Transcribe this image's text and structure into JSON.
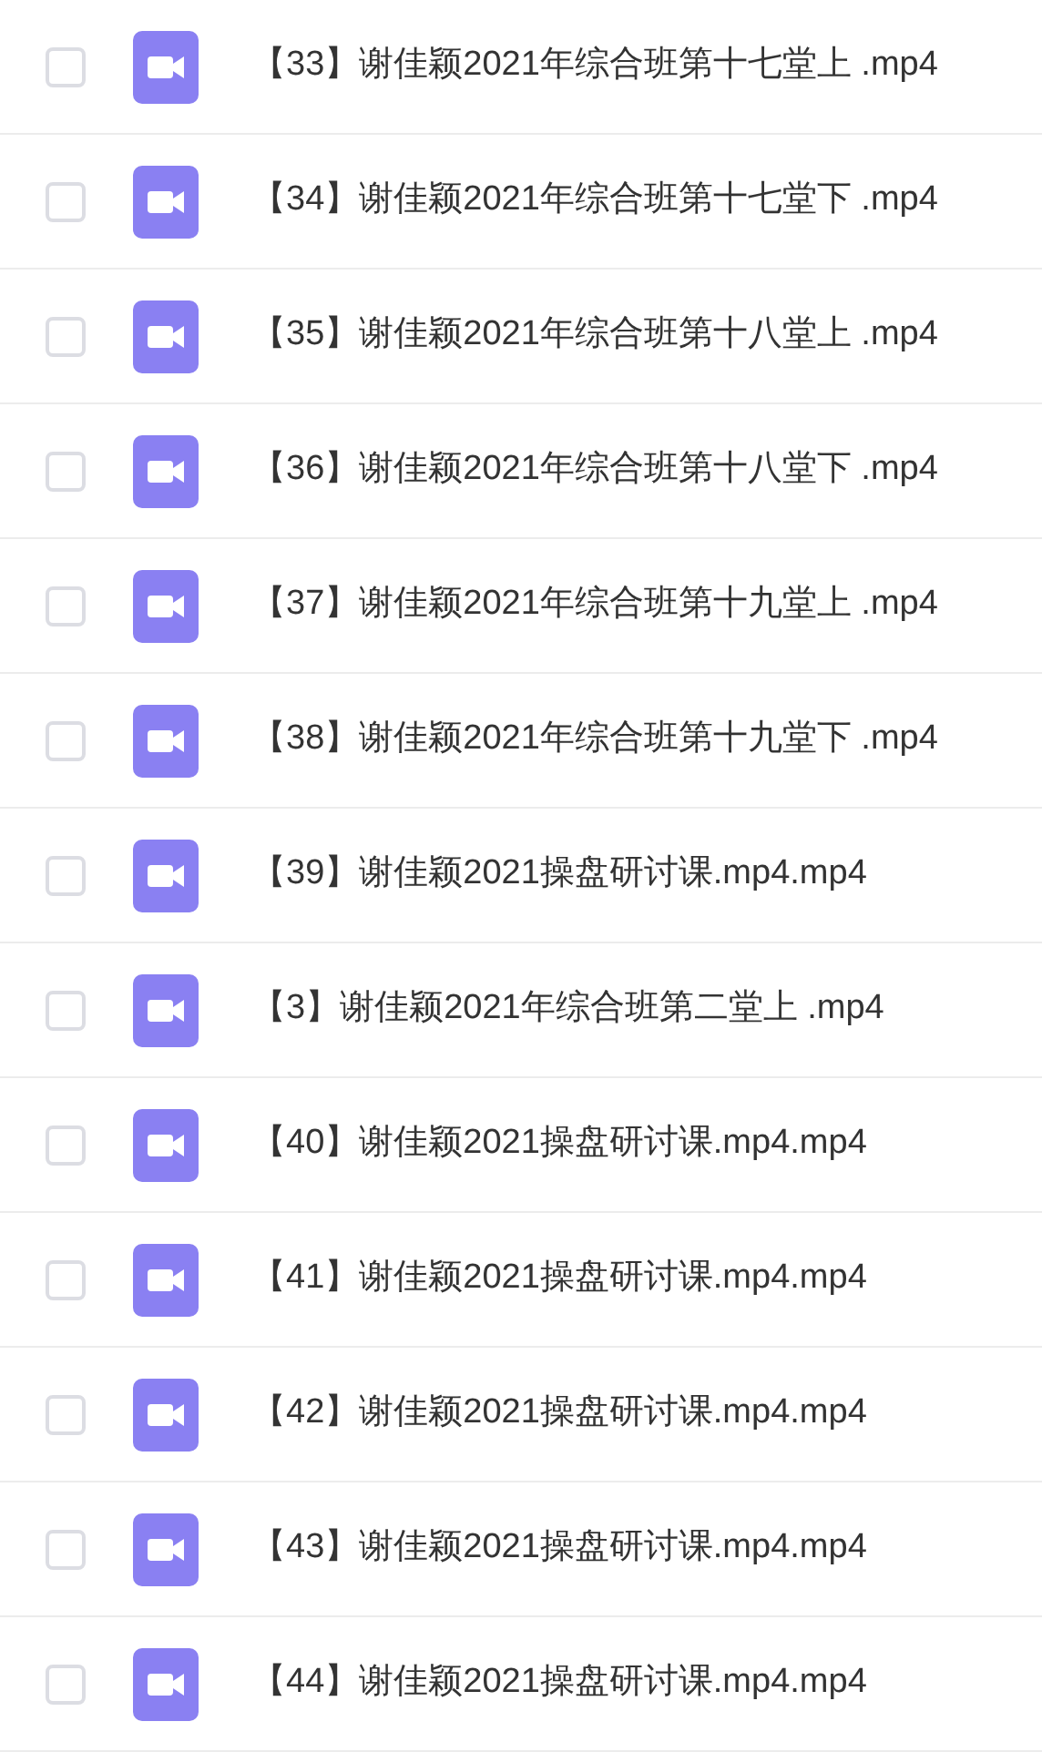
{
  "files": [
    {
      "name": "【33】谢佳颖2021年综合班第十七堂上 .mp4",
      "checked": false
    },
    {
      "name": "【34】谢佳颖2021年综合班第十七堂下 .mp4",
      "checked": false
    },
    {
      "name": "【35】谢佳颖2021年综合班第十八堂上 .mp4",
      "checked": false
    },
    {
      "name": "【36】谢佳颖2021年综合班第十八堂下 .mp4",
      "checked": false
    },
    {
      "name": "【37】谢佳颖2021年综合班第十九堂上 .mp4",
      "checked": false
    },
    {
      "name": "【38】谢佳颖2021年综合班第十九堂下 .mp4",
      "checked": false
    },
    {
      "name": "【39】谢佳颖2021操盘研讨课.mp4.mp4",
      "checked": false
    },
    {
      "name": "【3】谢佳颖2021年综合班第二堂上 .mp4",
      "checked": false
    },
    {
      "name": "【40】谢佳颖2021操盘研讨课.mp4.mp4",
      "checked": false
    },
    {
      "name": "【41】谢佳颖2021操盘研讨课.mp4.mp4",
      "checked": false
    },
    {
      "name": "【42】谢佳颖2021操盘研讨课.mp4.mp4",
      "checked": false
    },
    {
      "name": "【43】谢佳颖2021操盘研讨课.mp4.mp4",
      "checked": false
    },
    {
      "name": "【44】谢佳颖2021操盘研讨课.mp4.mp4",
      "checked": false
    }
  ]
}
